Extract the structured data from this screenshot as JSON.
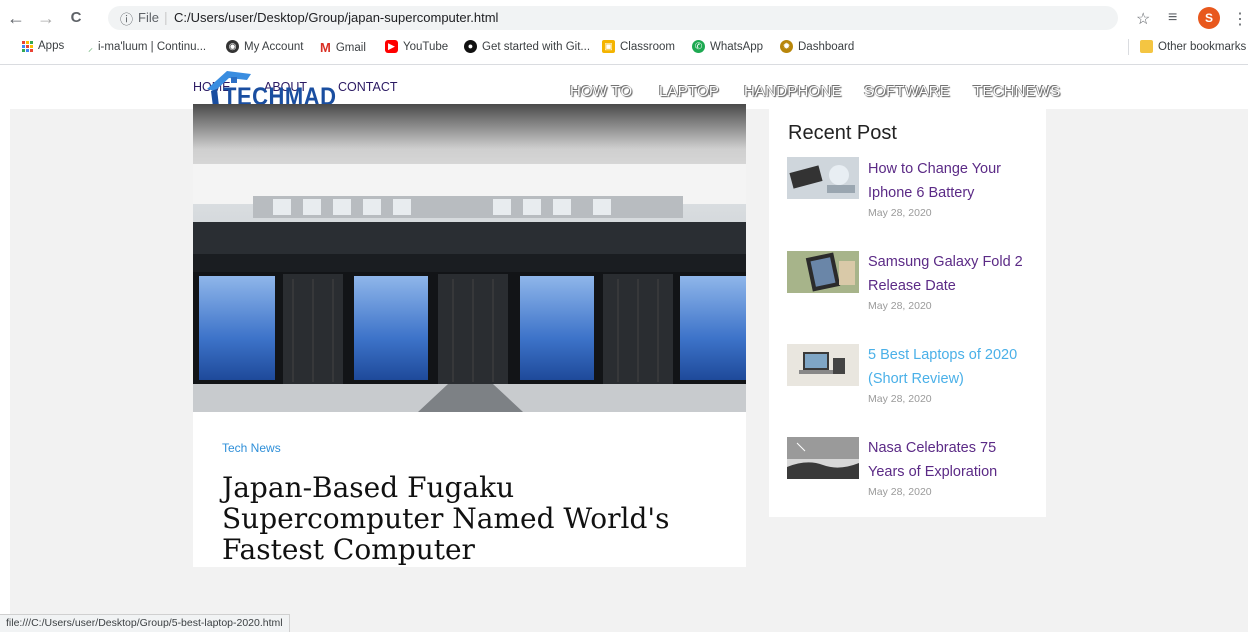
{
  "browser": {
    "back": "←",
    "forward": "→",
    "reload": "C",
    "info_icon": "ⓘ",
    "file_label": "File",
    "url": "C:/Users/user/Desktop/Group/japan-supercomputer.html",
    "avatar_letter": "S",
    "bookmarks": [
      "Apps",
      "i-ma'luum | Continu...",
      "My Account",
      "Gmail",
      "YouTube",
      "Get started with Git...",
      "Classroom",
      "WhatsApp",
      "Dashboard"
    ],
    "other_bookmarks": "Other bookmarks",
    "status_url": "file:///C:/Users/user/Desktop/Group/5-best-laptop-2020.html"
  },
  "topmenu": {
    "items": [
      "HOME",
      "ABOUT",
      "CONTACT"
    ]
  },
  "site": {
    "logo_text": "TECHMAD",
    "nav": [
      "HOW TO",
      "LAPTOP",
      "HANDPHONE",
      "SOFTWARE",
      "TECHNEWS"
    ]
  },
  "article": {
    "category": "Tech News",
    "title": "Japan-Based Fugaku Supercomputer Named World's Fastest Computer"
  },
  "sidebar": {
    "title": "Recent Post",
    "posts": [
      {
        "title": "How to Change Your Iphone 6 Battery",
        "date": "May 28, 2020"
      },
      {
        "title": "Samsung Galaxy Fold 2 Release Date",
        "date": "May 28, 2020"
      },
      {
        "title": "5 Best Laptops of 2020 (Short Review)",
        "date": "May 28, 2020"
      },
      {
        "title": "Nasa Celebrates 75 Years of Exploration",
        "date": "May 28, 2020"
      }
    ]
  },
  "colors": {
    "accent": "#2f8fd8",
    "link": "#5b2a86",
    "link_hover": "#4ab0e8",
    "brand": "#1a4ea0"
  }
}
